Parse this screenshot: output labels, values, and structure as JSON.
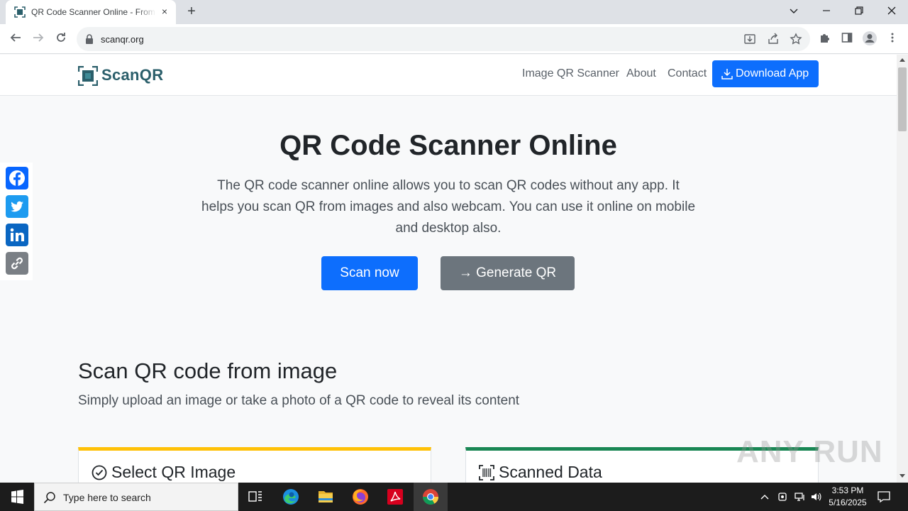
{
  "browser": {
    "tab_title": "QR Code Scanner Online - From Image",
    "url": "scanqr.org",
    "new_tab_symbol": "+",
    "tab_close_symbol": "×"
  },
  "site": {
    "logo_text": "ScanQR",
    "nav": [
      "Image QR Scanner",
      "About",
      "Contact"
    ],
    "download_label": "Download App",
    "brand_color": "#2b5f6b",
    "primary_color": "#0d6efd",
    "secondary_color": "#6c757d"
  },
  "hero": {
    "title": "QR Code Scanner Online",
    "description": "The QR code scanner online allows you to scan QR codes without any app. It helps you scan QR from images and also webcam. You can use it online on mobile and desktop also.",
    "scan_label": "Scan now",
    "generate_label": "→ Generate QR"
  },
  "section": {
    "title": "Scan QR code from image",
    "subtitle": "Simply upload an image or take a photo of a QR code to reveal its content",
    "card_select": "Select QR Image",
    "card_scanned": "Scanned Data",
    "card_select_accent": "#ffc107",
    "card_scanned_accent": "#198754"
  },
  "social": [
    "facebook-icon",
    "twitter-icon",
    "linkedin-icon",
    "copy-link-icon"
  ],
  "watermark": "ANY RUN",
  "taskbar": {
    "search_placeholder": "Type here to search",
    "time": "3:53 PM",
    "date": "5/16/2025"
  }
}
